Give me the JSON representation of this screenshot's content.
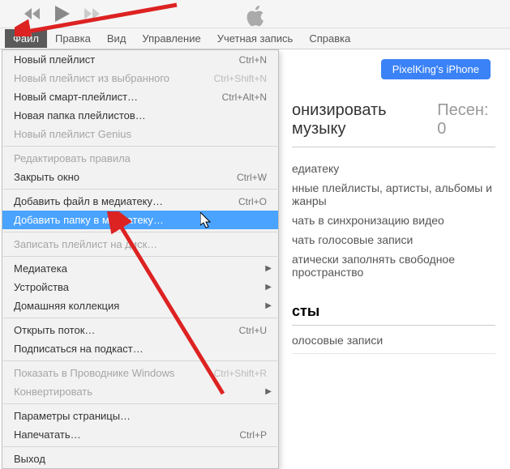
{
  "menubar": [
    "Файл",
    "Правка",
    "Вид",
    "Управление",
    "Учетная запись",
    "Справка"
  ],
  "active_menu_index": 0,
  "device_button": "PixelKing's iPhone",
  "sync": {
    "title_fragment": "онизировать музыку",
    "songs_label": "Песен: 0"
  },
  "options": [
    "едиатеку",
    "нные плейлисты, артисты, альбомы и жанры",
    "чать в синхронизацию видео",
    "чать голосовые записи",
    "атически заполнять свободное пространство"
  ],
  "playlists_header": "сты",
  "voice_row": "олосовые записи",
  "dropdown": [
    {
      "label": "Новый плейлист",
      "shortcut": "Ctrl+N",
      "disabled": false
    },
    {
      "label": "Новый плейлист из выбранного",
      "shortcut": "Ctrl+Shift+N",
      "disabled": true
    },
    {
      "label": "Новый смарт-плейлист…",
      "shortcut": "Ctrl+Alt+N",
      "disabled": false
    },
    {
      "label": "Новая папка плейлистов…",
      "shortcut": "",
      "disabled": false
    },
    {
      "label": "Новый плейлист Genius",
      "shortcut": "",
      "disabled": true
    },
    {
      "sep": true
    },
    {
      "label": "Редактировать правила",
      "shortcut": "",
      "disabled": true
    },
    {
      "label": "Закрыть окно",
      "shortcut": "Ctrl+W",
      "disabled": false
    },
    {
      "sep": true
    },
    {
      "label": "Добавить файл в медиатеку…",
      "shortcut": "Ctrl+O",
      "disabled": false
    },
    {
      "label": "Добавить папку в медиатеку…",
      "shortcut": "",
      "disabled": false,
      "hovered": true
    },
    {
      "sep": true
    },
    {
      "label": "Записать плейлист на диск…",
      "shortcut": "",
      "disabled": true
    },
    {
      "sep": true
    },
    {
      "label": "Медиатека",
      "shortcut": "",
      "disabled": false,
      "submenu": true
    },
    {
      "label": "Устройства",
      "shortcut": "",
      "disabled": false,
      "submenu": true
    },
    {
      "label": "Домашняя коллекция",
      "shortcut": "",
      "disabled": false,
      "submenu": true
    },
    {
      "sep": true
    },
    {
      "label": "Открыть поток…",
      "shortcut": "Ctrl+U",
      "disabled": false
    },
    {
      "label": "Подписаться на подкаст…",
      "shortcut": "",
      "disabled": false
    },
    {
      "sep": true
    },
    {
      "label": "Показать в Проводнике Windows",
      "shortcut": "Ctrl+Shift+R",
      "disabled": true
    },
    {
      "label": "Конвертировать",
      "shortcut": "",
      "disabled": true,
      "submenu": true
    },
    {
      "sep": true
    },
    {
      "label": "Параметры страницы…",
      "shortcut": "",
      "disabled": false
    },
    {
      "label": "Напечатать…",
      "shortcut": "Ctrl+P",
      "disabled": false
    },
    {
      "sep": true
    },
    {
      "label": "Выход",
      "shortcut": "",
      "disabled": false
    }
  ]
}
